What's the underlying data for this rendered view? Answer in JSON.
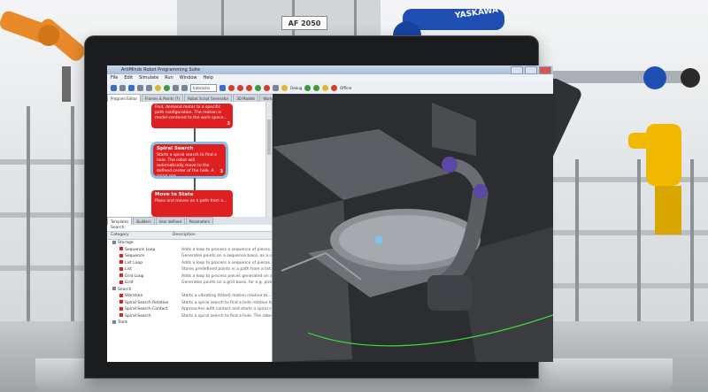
{
  "background": {
    "sign_text": "AF 2050",
    "robot_brand": "YASKAWA"
  },
  "app": {
    "title": "ArtiMinds Robot Programming Suite",
    "menu": [
      "File",
      "Edit",
      "Simulate",
      "Run",
      "Window",
      "Help"
    ],
    "toolbar_combo": "Interactiv",
    "toolbar_labels": [
      "Debug",
      "Offline"
    ]
  },
  "editor": {
    "tabs": [
      "Program Editor",
      "Frames & Points (7)",
      "Robot Script Generator",
      "3D Models",
      "Workpieces"
    ],
    "blocks": [
      {
        "title": "",
        "body": "Find, demand motor to a specific path configuration. The motion is model-centered to the work space...",
        "num": "3"
      },
      {
        "title": "Spiral Search",
        "body": "Starts a spiral search to find a hole. The robot will automatically move to the defined center of the hole. A spiral sea...",
        "num": "3"
      },
      {
        "title": "Move to State",
        "body": "Plans and moves on a path from a...",
        "num": ""
      }
    ]
  },
  "templates": {
    "tabs": [
      "Templates",
      "Builders",
      "User defined",
      "Parameters"
    ],
    "search_label": "Search:",
    "columns": [
      "Category",
      "Description"
    ],
    "rows": [
      {
        "name": "Storage",
        "desc": ""
      },
      {
        "name": "Sequence Loop",
        "desc": "Adds a loop to process a sequence of pieces..."
      },
      {
        "name": "Sequence",
        "desc": "Generates points on a sequence basis, as a s..."
      },
      {
        "name": "List Loop",
        "desc": "Adds a loop to process a sequence of pieces..."
      },
      {
        "name": "List",
        "desc": "Stores predefined points in a path from a list..."
      },
      {
        "name": "Grid Loop",
        "desc": "Adds a loop to process pieces generated on a..."
      },
      {
        "name": "Grid",
        "desc": "Generates points on a grid basis, for e.g. pick..."
      },
      {
        "name": "Search",
        "desc": ""
      },
      {
        "name": "Vibration",
        "desc": "Starts a vibrating (tilted) motion relative to..."
      },
      {
        "name": "Spiral Search Relative",
        "desc": "Starts a spiral search to find a hole relative to..."
      },
      {
        "name": "Spiral Search Contact",
        "desc": "Approaches with contact and starts a spiral s..."
      },
      {
        "name": "Spiral Search",
        "desc": "Starts a spiral search to find a hole. The robot..."
      },
      {
        "name": "Tools",
        "desc": ""
      }
    ]
  },
  "colors": {
    "block_red": "#e02020",
    "highlight_blue": "#7fc3e8",
    "robot_blue": "#1f4fb5",
    "robot_orange": "#e88a2a",
    "robot_yellow": "#f0b800"
  }
}
